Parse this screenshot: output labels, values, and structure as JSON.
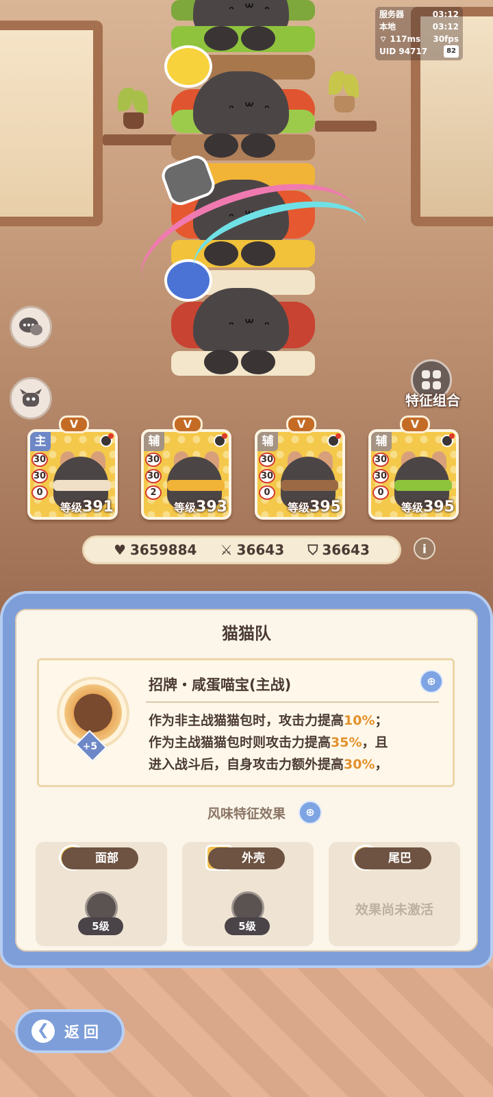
{
  "status": {
    "server_label": "服务器",
    "server_time": "03:12",
    "local_label": "本地",
    "local_time": "03:12",
    "ping": "117ms",
    "fps": "30fps",
    "uid_label": "UID",
    "uid": "94717",
    "battery": "82"
  },
  "side": {
    "traits_combo_label": "特征组合"
  },
  "team": [
    {
      "role": "主",
      "tag": "V",
      "stats": [
        "30",
        "30",
        "0"
      ],
      "level_label": "等级",
      "level": "391",
      "band_color": "#f0e0c8",
      "role_color": "#6d87c7"
    },
    {
      "role": "辅",
      "tag": "V",
      "stats": [
        "30",
        "30",
        "2"
      ],
      "level_label": "等级",
      "level": "393",
      "band_color": "#f2b437",
      "role_color": "#a59384"
    },
    {
      "role": "辅",
      "tag": "V",
      "stats": [
        "30",
        "30",
        "0"
      ],
      "level_label": "等级",
      "level": "395",
      "band_color": "#9b6a45",
      "role_color": "#a59384"
    },
    {
      "role": "辅",
      "tag": "V",
      "stats": [
        "30",
        "30",
        "0"
      ],
      "level_label": "等级",
      "level": "395",
      "band_color": "#8ec33c",
      "role_color": "#a59384"
    }
  ],
  "stats_bar": {
    "hp": "3659884",
    "attack": "36643",
    "defense": "36643"
  },
  "panel": {
    "title": "猫猫队",
    "skill_name": "招牌・咸蛋喵宝(主战)",
    "skill_bonus": "+5",
    "desc_line1_a": "作为非主战猫猫包时，攻击力提高",
    "desc_line1_hl": "10%",
    "desc_line1_b": "；",
    "desc_line2_a": "作为主战猫猫包时则攻击力提高",
    "desc_line2_hl": "35%",
    "desc_line2_b": "，且",
    "desc_line3_a": "进入战斗后，自身攻击力额外提高",
    "desc_line3_hl": "30%",
    "desc_line3_b": "，",
    "flavor_title": "风味特征效果",
    "traits": [
      {
        "name": "面部",
        "level": "5级"
      },
      {
        "name": "外壳",
        "level": "5级"
      },
      {
        "name": "尾巴",
        "inactive_text": "效果尚未激活"
      }
    ]
  },
  "back_label": "返回",
  "colors": {
    "panel_blue": "#7d9ed9",
    "highlight_orange": "#e3902a",
    "card_yellow": "#f4c84a"
  }
}
